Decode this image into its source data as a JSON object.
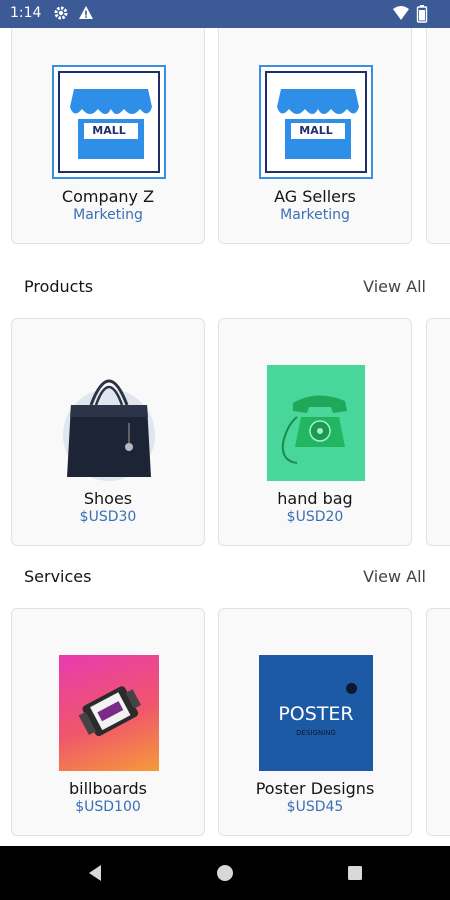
{
  "status_bar": {
    "time": "1:14",
    "icons": [
      "gear-icon",
      "alert-icon",
      "wifi-icon",
      "battery-icon"
    ],
    "color": "#3c5a96"
  },
  "stores": [
    {
      "name": "Company Z",
      "category": "Marketing",
      "logo_text": "MALL"
    },
    {
      "name": "AG Sellers",
      "category": "Marketing",
      "logo_text": "MALL"
    }
  ],
  "products": {
    "title": "Products",
    "view_all": "View All",
    "items": [
      {
        "name": "Shoes",
        "price": "$USD30",
        "image": "handbag-image"
      },
      {
        "name": "hand bag",
        "price": "$USD20",
        "image": "telephone-image"
      }
    ]
  },
  "services": {
    "title": "Services",
    "view_all": "View All",
    "items": [
      {
        "name": "billboards",
        "price": "$USD100",
        "image": "film-roll-image"
      },
      {
        "name": "Poster Designs",
        "price": "$USD45",
        "image": "poster-image",
        "image_text": "POSTER",
        "image_subtext": "DESIGNING"
      }
    ]
  },
  "colors": {
    "accent": "#3a6fb5",
    "status_bar": "#3c5a96",
    "nav_bar": "#000000"
  }
}
